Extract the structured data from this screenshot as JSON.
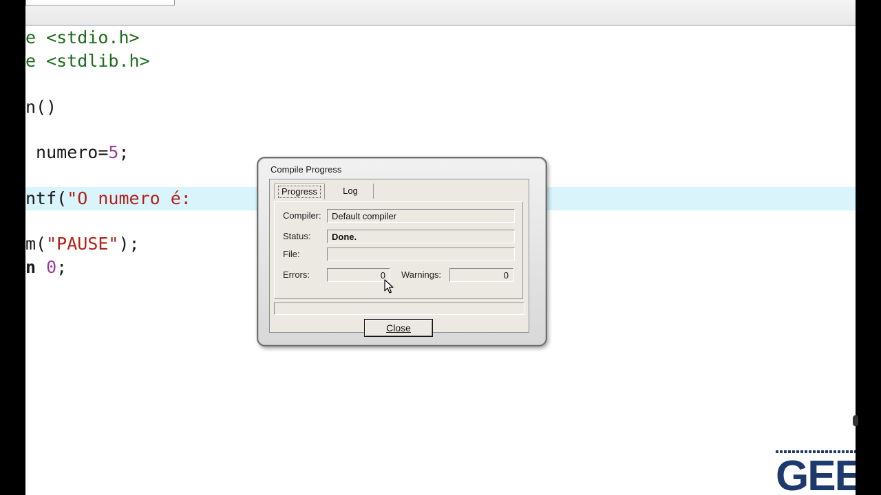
{
  "editor": {
    "lines": [
      {
        "a": "e ",
        "b": "<stdio.h>"
      },
      {
        "a": "e ",
        "b": "<stdlib.h>"
      },
      {
        "a": "n()"
      },
      {
        "a": " numero=",
        "n": "5",
        "c": ";"
      },
      {
        "a": "ntf(",
        "s": "\"O numero é:"
      },
      {
        "a": "m(",
        "s": "\"PAUSE\"",
        "c": ");"
      },
      {
        "a": "n ",
        "n": "0",
        "c": ";"
      }
    ]
  },
  "dialog": {
    "title": "Compile Progress",
    "tabs": [
      "Progress",
      "Log"
    ],
    "labels": {
      "compiler": "Compiler:",
      "status": "Status:",
      "file": "File:",
      "errors": "Errors:",
      "warnings": "Warnings:"
    },
    "values": {
      "compiler": "Default compiler",
      "status": "Done.",
      "file": "",
      "errors": "0",
      "warnings": "0"
    },
    "progress_fraction": 0,
    "close_label": "Close"
  },
  "logo": {
    "text": "GEE"
  },
  "colors": {
    "highlight": "#d9f5fb",
    "preprocessor": "#1c6d1c",
    "string": "#b3201a",
    "number": "#9a3d9a",
    "logo": "#1d3a6c"
  }
}
